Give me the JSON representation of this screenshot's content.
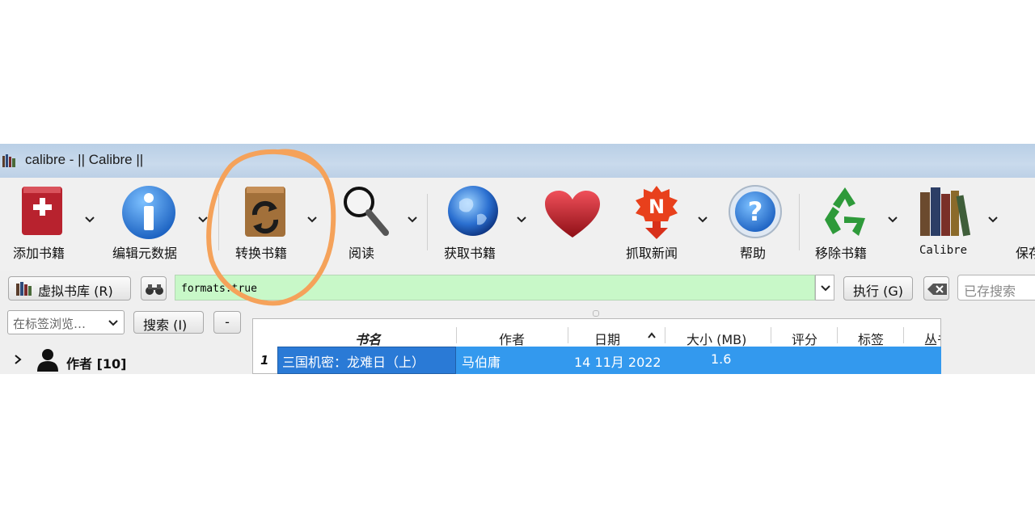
{
  "window": {
    "title": "calibre - || Calibre ||"
  },
  "toolbar": {
    "add_books": "添加书籍",
    "edit_metadata": "编辑元数据",
    "convert_books": "转换书籍",
    "view": "阅读",
    "get_books": "获取书籍",
    "fetch_news": "抓取新闻",
    "help": "帮助",
    "remove_books": "移除书籍",
    "calibre_library": "Calibre",
    "save": "保存"
  },
  "search_row": {
    "virtual_library": "虚拟书库 (R)",
    "search_value": "formats:true",
    "execute": "执行 (G)",
    "saved_search_placeholder": "已存搜索"
  },
  "tag_browser": {
    "filter_placeholder": "在标签浏览…",
    "search_button": "搜索 (I)",
    "collapse_button": "-",
    "authors_label": "作者 [10]"
  },
  "book_table": {
    "columns": [
      "书名",
      "作者",
      "日期",
      "大小 (MB)",
      "评分",
      "标签",
      "丛书"
    ],
    "rows": [
      {
        "num": "1",
        "title": "三国机密：龙难日（上）",
        "author": "马伯庸",
        "date": "14 11月 2022",
        "size": "1.6"
      }
    ]
  },
  "colors": {
    "selection": "#3399ee",
    "search_field_bg": "#c8f8c8",
    "annotation": "#f5a25a"
  }
}
